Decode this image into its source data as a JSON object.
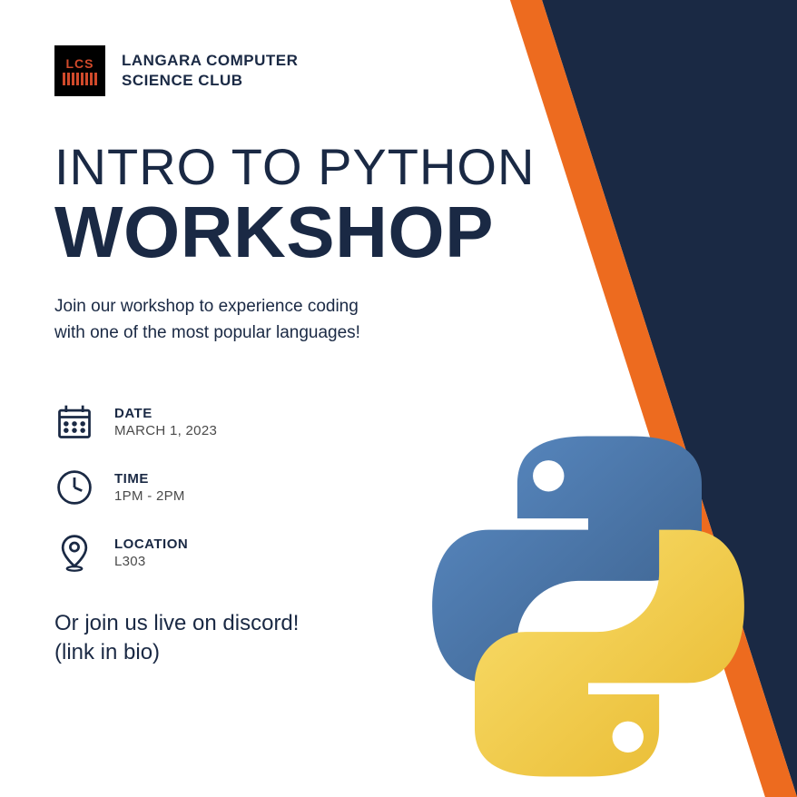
{
  "club": {
    "logo_text": "LCS",
    "name_line1": "LANGARA COMPUTER",
    "name_line2": "SCIENCE CLUB"
  },
  "title": {
    "line1": "INTRO TO PYTHON",
    "line2": "WORKSHOP"
  },
  "subtitle": {
    "line1": "Join our workshop to experience coding",
    "line2": "with one of the most popular languages!"
  },
  "details": {
    "date": {
      "label": "DATE",
      "value": "MARCH 1, 2023"
    },
    "time": {
      "label": "TIME",
      "value": "1PM - 2PM"
    },
    "location": {
      "label": "LOCATION",
      "value": "L303"
    }
  },
  "bottom": {
    "line1": "Or join us live on discord!",
    "line2": "(link in bio)"
  },
  "colors": {
    "navy": "#1a2944",
    "orange": "#ed6b1f",
    "python_blue": "#4b76a8",
    "python_yellow": "#f6cc4c"
  }
}
